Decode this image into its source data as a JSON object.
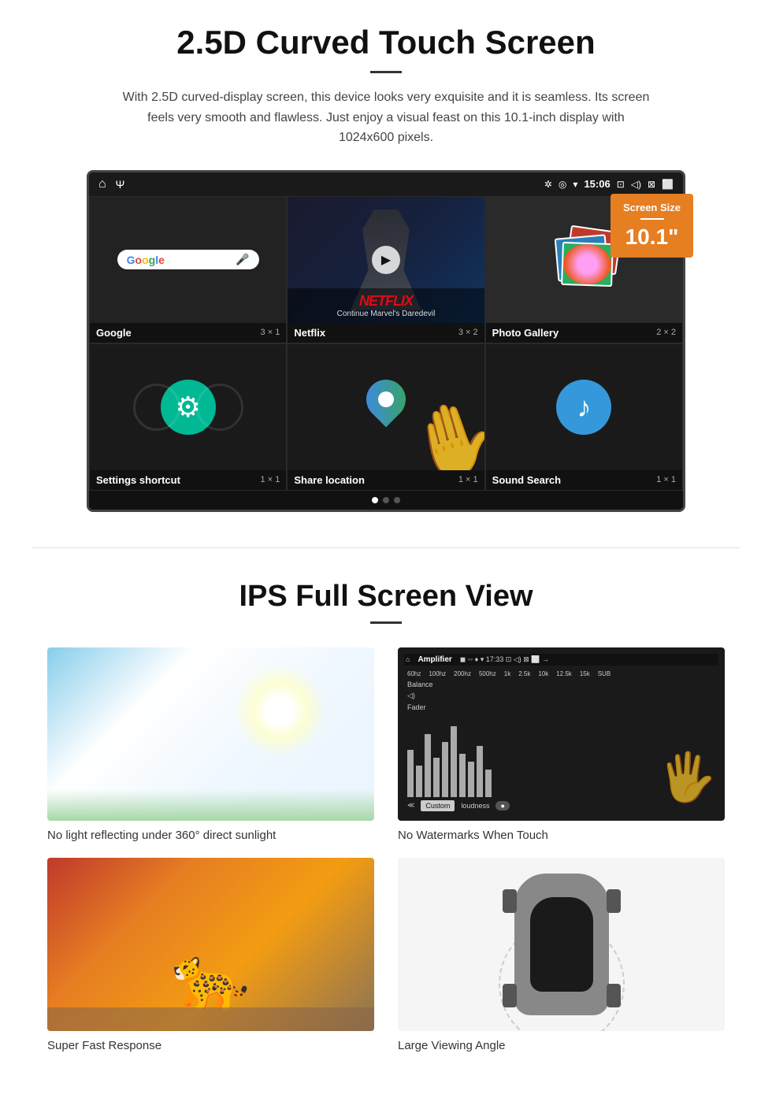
{
  "section1": {
    "title": "2.5D Curved Touch Screen",
    "description": "With 2.5D curved-display screen, this device looks very exquisite and it is seamless. Its screen feels very smooth and flawless. Just enjoy a visual feast on this 10.1-inch display with 1024x600 pixels.",
    "status_time": "15:06",
    "screen_size_badge": {
      "title": "Screen Size",
      "size": "10.1\""
    },
    "apps": [
      {
        "name": "Google",
        "size": "3 × 1",
        "type": "google"
      },
      {
        "name": "Netflix",
        "size": "3 × 2",
        "type": "netflix"
      },
      {
        "name": "Photo Gallery",
        "size": "2 × 2",
        "type": "gallery"
      },
      {
        "name": "Settings shortcut",
        "size": "1 × 1",
        "type": "settings"
      },
      {
        "name": "Share location",
        "size": "1 × 1",
        "type": "share"
      },
      {
        "name": "Sound Search",
        "size": "1 × 1",
        "type": "sound"
      }
    ],
    "netflix": {
      "brand": "NETFLIX",
      "subtitle": "Continue Marvel's Daredevil"
    }
  },
  "section2": {
    "title": "IPS Full Screen View",
    "features": [
      {
        "label": "No light reflecting under 360° direct sunlight",
        "type": "sunlight"
      },
      {
        "label": "No Watermarks When Touch",
        "type": "amplifier"
      },
      {
        "label": "Super Fast Response",
        "type": "cheetah"
      },
      {
        "label": "Large Viewing Angle",
        "type": "car"
      }
    ]
  }
}
